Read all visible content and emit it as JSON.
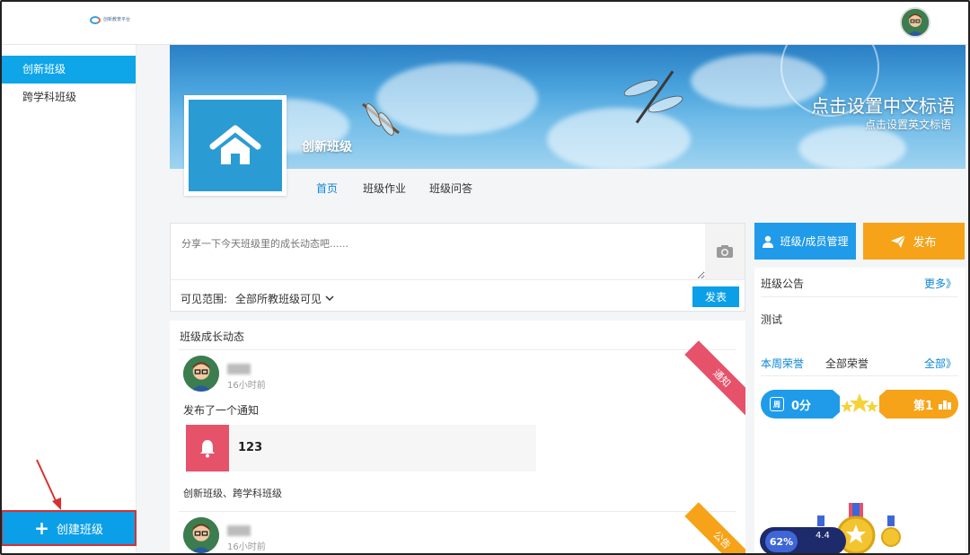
{
  "header": {
    "logo_text": "创新教育平台",
    "avatar_label": "用户头像"
  },
  "sidebar": {
    "items": [
      {
        "label": "创新班级",
        "active": true
      },
      {
        "label": "跨学科班级",
        "active": false
      }
    ],
    "create_button": "创建班级"
  },
  "banner": {
    "slogan_cn": "点击设置中文标语",
    "slogan_en": "点击设置英文标语",
    "class_name": "创新班级"
  },
  "tabs": [
    {
      "label": "首页",
      "active": true
    },
    {
      "label": "班级作业",
      "active": false
    },
    {
      "label": "班级问答",
      "active": false
    }
  ],
  "composer": {
    "placeholder": "分享一下今天班级里的成长动态吧......",
    "scope_label": "可见范围:",
    "scope_value": "全部所教班级可见",
    "submit": "发表"
  },
  "feed": {
    "title": "班级成长动态",
    "items": [
      {
        "time": "16小时前",
        "action": "发布了一个通知",
        "card_value": "123",
        "classes": "创新班级、跨学科班级",
        "ribbon": "通知",
        "ribbon_color": "#e5526a"
      },
      {
        "time": "16小时前",
        "ribbon": "公告",
        "ribbon_color": "#f6a319"
      }
    ]
  },
  "right": {
    "manage_button": "班级/成员管理",
    "publish_button": "发布",
    "notice_label": "班级公告",
    "notice_more": "更多》",
    "notice_text": "测试",
    "honor_tab_week": "本周荣誉",
    "honor_tab_all": "全部荣誉",
    "honor_more": "全部》",
    "score_week_icon": "周",
    "score_value": "0分",
    "rank": "第1",
    "speed_percent": "62%",
    "speed_up": "4.4"
  },
  "colors": {
    "primary": "#0b9fe8",
    "accent": "#f6a319",
    "notice_red": "#e5526a",
    "annotation_red": "#d93030"
  }
}
